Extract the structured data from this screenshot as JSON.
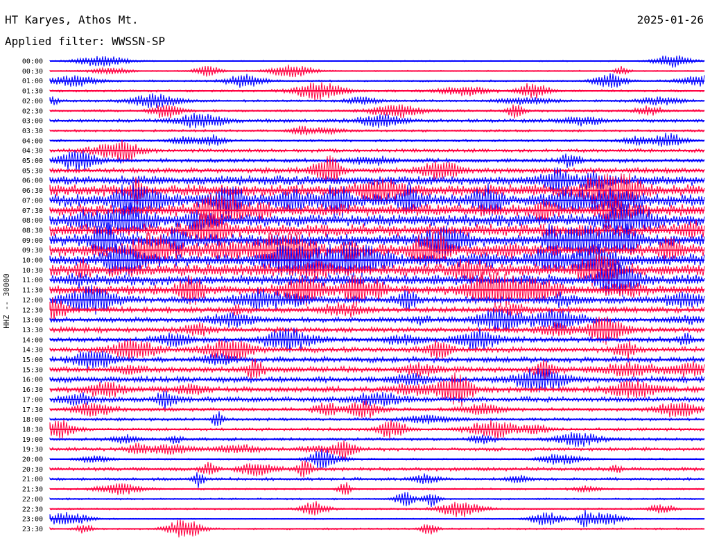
{
  "header": {
    "station": "HT Karyes, Athos Mt.",
    "date": "2025-01-26",
    "filter": "Applied filter: WWSSN-SP"
  },
  "channel_label": "HHZ -- 30000",
  "colors": {
    "odd_trace": "#0000ff",
    "even_trace": "#ff0040",
    "text": "#000000"
  },
  "chart_data": {
    "type": "line",
    "title": "HT Karyes, Athos Mt.",
    "subtitle": "Applied filter: WWSSN-SP",
    "ylabel": "HHZ -- 30000",
    "xlabel": "",
    "date": "2025-01-26",
    "rows": [
      {
        "label": "00:00",
        "color": "#0000ff",
        "activity": 0.05
      },
      {
        "label": "00:30",
        "color": "#ff0040",
        "activity": 0.05
      },
      {
        "label": "01:00",
        "color": "#0000ff",
        "activity": 0.1
      },
      {
        "label": "01:30",
        "color": "#ff0040",
        "activity": 0.15
      },
      {
        "label": "02:00",
        "color": "#0000ff",
        "activity": 0.15
      },
      {
        "label": "02:30",
        "color": "#ff0040",
        "activity": 0.15
      },
      {
        "label": "03:00",
        "color": "#0000ff",
        "activity": 0.25
      },
      {
        "label": "03:30",
        "color": "#ff0040",
        "activity": 0.15
      },
      {
        "label": "04:00",
        "color": "#0000ff",
        "activity": 0.15
      },
      {
        "label": "04:30",
        "color": "#ff0040",
        "activity": 0.25
      },
      {
        "label": "05:00",
        "color": "#0000ff",
        "activity": 0.3
      },
      {
        "label": "05:30",
        "color": "#ff0040",
        "activity": 0.4
      },
      {
        "label": "06:00",
        "color": "#0000ff",
        "activity": 0.75
      },
      {
        "label": "06:30",
        "color": "#ff0040",
        "activity": 0.95
      },
      {
        "label": "07:00",
        "color": "#0000ff",
        "activity": 1.0
      },
      {
        "label": "07:30",
        "color": "#ff0040",
        "activity": 1.0
      },
      {
        "label": "08:00",
        "color": "#0000ff",
        "activity": 1.0
      },
      {
        "label": "08:30",
        "color": "#ff0040",
        "activity": 1.0
      },
      {
        "label": "09:00",
        "color": "#0000ff",
        "activity": 1.0
      },
      {
        "label": "09:30",
        "color": "#ff0040",
        "activity": 1.0
      },
      {
        "label": "10:00",
        "color": "#0000ff",
        "activity": 1.0
      },
      {
        "label": "10:30",
        "color": "#ff0040",
        "activity": 1.0
      },
      {
        "label": "11:00",
        "color": "#0000ff",
        "activity": 0.85
      },
      {
        "label": "11:30",
        "color": "#ff0040",
        "activity": 0.75
      },
      {
        "label": "12:00",
        "color": "#0000ff",
        "activity": 0.55
      },
      {
        "label": "12:30",
        "color": "#ff0040",
        "activity": 0.45
      },
      {
        "label": "13:00",
        "color": "#0000ff",
        "activity": 0.4
      },
      {
        "label": "13:30",
        "color": "#ff0040",
        "activity": 0.4
      },
      {
        "label": "14:00",
        "color": "#0000ff",
        "activity": 0.4
      },
      {
        "label": "14:30",
        "color": "#ff0040",
        "activity": 0.4
      },
      {
        "label": "15:00",
        "color": "#0000ff",
        "activity": 0.45
      },
      {
        "label": "15:30",
        "color": "#ff0040",
        "activity": 0.45
      },
      {
        "label": "16:00",
        "color": "#0000ff",
        "activity": 0.45
      },
      {
        "label": "16:30",
        "color": "#ff0040",
        "activity": 0.45
      },
      {
        "label": "17:00",
        "color": "#0000ff",
        "activity": 0.4
      },
      {
        "label": "17:30",
        "color": "#ff0040",
        "activity": 0.25
      },
      {
        "label": "18:00",
        "color": "#0000ff",
        "activity": 0.2
      },
      {
        "label": "18:30",
        "color": "#ff0040",
        "activity": 0.2
      },
      {
        "label": "19:00",
        "color": "#0000ff",
        "activity": 0.2
      },
      {
        "label": "19:30",
        "color": "#ff0040",
        "activity": 0.25
      },
      {
        "label": "20:00",
        "color": "#0000ff",
        "activity": 0.1
      },
      {
        "label": "20:30",
        "color": "#ff0040",
        "activity": 0.25
      },
      {
        "label": "21:00",
        "color": "#0000ff",
        "activity": 0.2
      },
      {
        "label": "21:30",
        "color": "#ff0040",
        "activity": 0.1
      },
      {
        "label": "22:00",
        "color": "#0000ff",
        "activity": 0.1
      },
      {
        "label": "22:30",
        "color": "#ff0040",
        "activity": 0.1
      },
      {
        "label": "23:00",
        "color": "#0000ff",
        "activity": 0.05
      },
      {
        "label": "23:30",
        "color": "#ff0040",
        "activity": 0.1
      }
    ],
    "grid": false,
    "legend": "none"
  }
}
